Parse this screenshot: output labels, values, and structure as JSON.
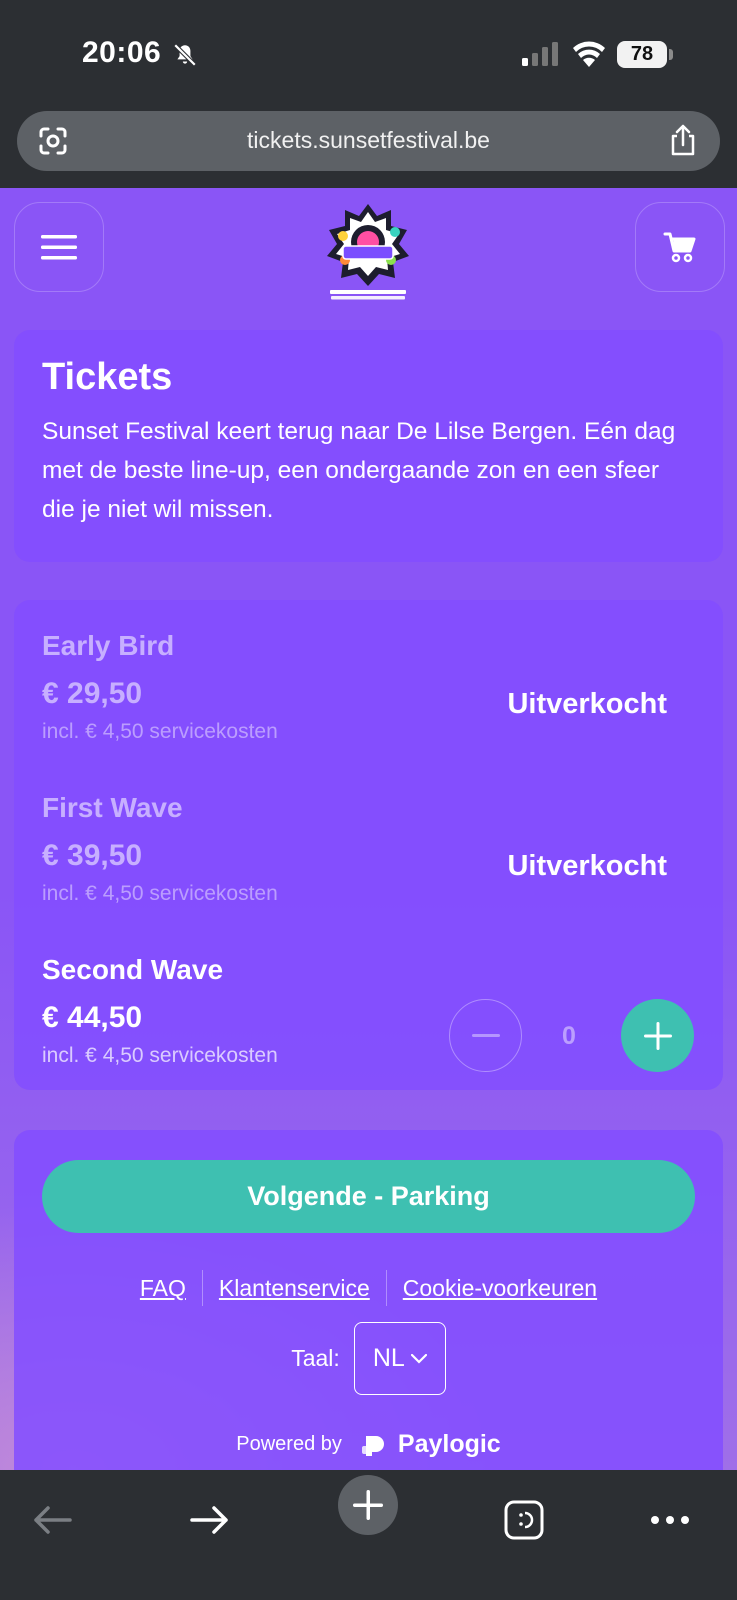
{
  "status_bar": {
    "time": "20:06",
    "battery": "78"
  },
  "browser": {
    "url": "tickets.sunsetfestival.be"
  },
  "intro": {
    "title": "Tickets",
    "text": "Sunset Festival keert terug naar De Lilse Bergen. Eén dag met de beste line-up, een ondergaande zon en een sfeer die je niet wil missen."
  },
  "tickets": [
    {
      "name": "Early Bird",
      "price": "€ 29,50",
      "fee": "incl. € 4,50 servicekosten",
      "status": "Uitverkocht"
    },
    {
      "name": "First Wave",
      "price": "€ 39,50",
      "fee": "incl. € 4,50 servicekosten",
      "status": "Uitverkocht"
    },
    {
      "name": "Second Wave",
      "price": "€ 44,50",
      "fee": "incl. € 4,50 servicekosten",
      "quantity": "0"
    }
  ],
  "footer": {
    "next_label": "Volgende - Parking",
    "links": [
      "FAQ",
      "Klantenservice",
      "Cookie-voorkeuren"
    ],
    "language_label": "Taal:",
    "language_value": "NL",
    "powered_by": "Powered by",
    "provider": "Paylogic"
  },
  "colors": {
    "page_purple": "#8a55f6",
    "card_purple": "#834eff",
    "teal_accent": "#3ec0b1",
    "chrome_dark": "#2c2f33"
  }
}
